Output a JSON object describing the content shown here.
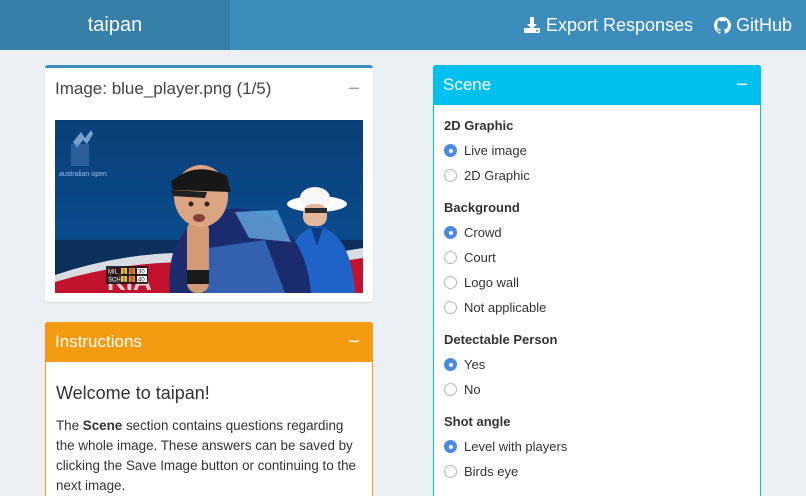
{
  "header": {
    "brand": "taipan",
    "export_label": "Export Responses",
    "github_label": "GitHub",
    "bar_color": "#3c8dbc",
    "brand_color": "#367fa9"
  },
  "image_box": {
    "title": "Image: blue_player.png (1/5)",
    "collapse_icon": "minus-icon",
    "photo": {
      "logo_line1": "australian open",
      "scoreboard": [
        {
          "name": "MIL",
          "sets": "1",
          "games": "0",
          "points": "30"
        },
        {
          "name": "SCH",
          "sets": "1",
          "games": "2",
          "points": "40"
        }
      ]
    }
  },
  "instructions": {
    "title": "Instructions",
    "heading": "Welcome to taipan!",
    "text_before": "The ",
    "text_bold": "Scene",
    "text_after": " section contains questions regarding the whole image. These answers can be saved by clicking the Save Image button or continuing to the next image.",
    "accent": "#f39c12"
  },
  "scene": {
    "title": "Scene",
    "accent": "#00c0ef",
    "questions": [
      {
        "label": "2D Graphic",
        "options": [
          {
            "label": "Live image",
            "checked": true
          },
          {
            "label": "2D Graphic",
            "checked": false
          }
        ]
      },
      {
        "label": "Background",
        "options": [
          {
            "label": "Crowd",
            "checked": true
          },
          {
            "label": "Court",
            "checked": false
          },
          {
            "label": "Logo wall",
            "checked": false
          },
          {
            "label": "Not applicable",
            "checked": false
          }
        ]
      },
      {
        "label": "Detectable Person",
        "options": [
          {
            "label": "Yes",
            "checked": true
          },
          {
            "label": "No",
            "checked": false
          }
        ]
      },
      {
        "label": "Shot angle",
        "options": [
          {
            "label": "Level with players",
            "checked": true
          },
          {
            "label": "Birds eye",
            "checked": false
          }
        ]
      }
    ]
  }
}
